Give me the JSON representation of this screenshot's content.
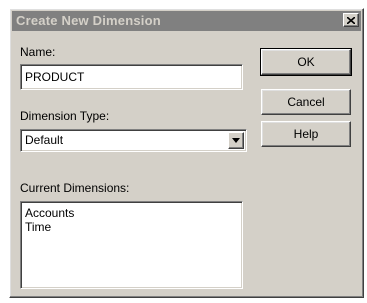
{
  "window": {
    "title": "Create New Dimension",
    "close_icon": "close-icon"
  },
  "form": {
    "name_label": "Name:",
    "name_value": "PRODUCT",
    "type_label": "Dimension Type:",
    "type_value": "Default",
    "current_label": "Current Dimensions:",
    "current_items": [
      "Accounts",
      "Time"
    ]
  },
  "buttons": {
    "ok": "OK",
    "cancel": "Cancel",
    "help": "Help"
  },
  "colors": {
    "face": "#d4d0c8",
    "title_bar": "#808080",
    "title_text": "#d4d0c8"
  }
}
